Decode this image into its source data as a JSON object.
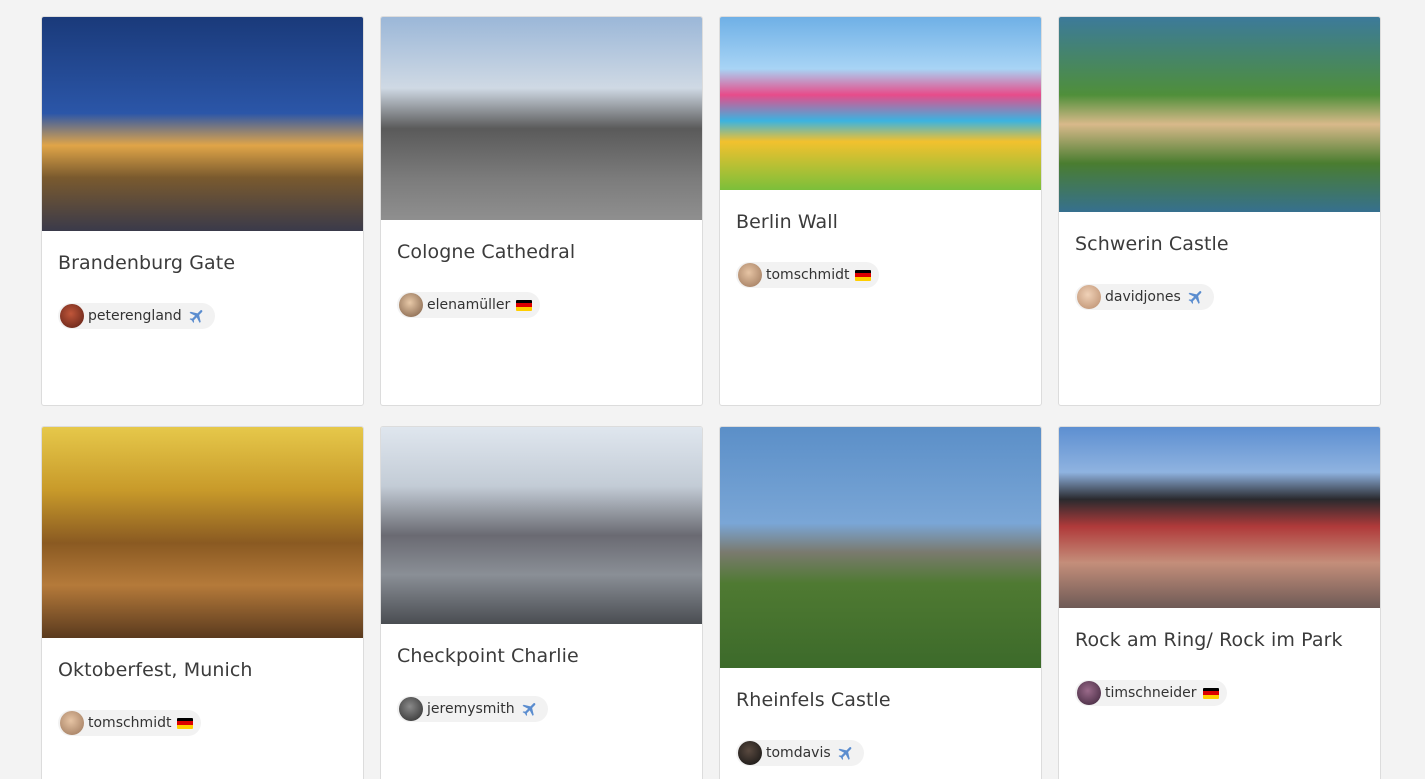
{
  "cards": [
    {
      "title": "Brandenburg Gate",
      "user": "peterengland",
      "badge": "plane",
      "image_name": "brandenburg-gate-photo"
    },
    {
      "title": "Cologne Cathedral",
      "user": "elenamüller",
      "badge": "flag-de",
      "image_name": "cologne-cathedral-photo"
    },
    {
      "title": "Berlin Wall",
      "user": "tomschmidt",
      "badge": "flag-de",
      "image_name": "berlin-wall-photo"
    },
    {
      "title": "Schwerin Castle",
      "user": "davidjones",
      "badge": "plane",
      "image_name": "schwerin-castle-photo"
    },
    {
      "title": "Oktoberfest, Munich",
      "user": "tomschmidt",
      "badge": "flag-de",
      "image_name": "oktoberfest-photo"
    },
    {
      "title": "Checkpoint Charlie",
      "user": "jeremysmith",
      "badge": "plane",
      "image_name": "checkpoint-charlie-photo"
    },
    {
      "title": "Rheinfels Castle",
      "user": "tomdavis",
      "badge": "plane",
      "image_name": "rheinfels-castle-photo"
    },
    {
      "title": "Rock am Ring/ Rock im Park",
      "user": "timschneider",
      "badge": "flag-de",
      "image_name": "rock-am-ring-photo"
    }
  ],
  "colors": {
    "background": "#f3f3f3",
    "card": "#ffffff",
    "chip": "#f2f2f2",
    "plane_icon": "#5b8dcf"
  }
}
